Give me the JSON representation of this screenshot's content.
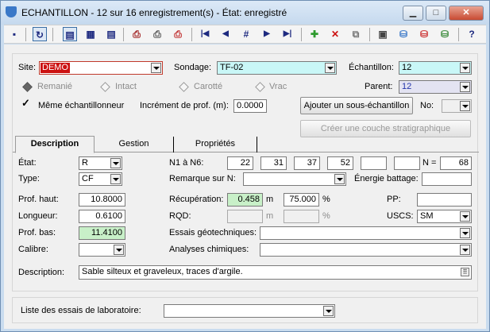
{
  "window": {
    "title": "ECHANTILLON - 12 sur 16 enregistrement(s) - État: enregistré",
    "minimize": "▁",
    "maximize": "□",
    "close": "✕"
  },
  "toolbar": {
    "icons": [
      "save-icon",
      "refresh-icon",
      "form-view-icon",
      "grid-view-icon",
      "list-view-icon",
      "print-icon",
      "print-all-icon",
      "print-delete-icon",
      "first-record-icon",
      "previous-record-icon",
      "goto-record-icon",
      "next-record-icon",
      "last-record-icon",
      "add-record-icon",
      "delete-record-icon",
      "copy-record-icon",
      "folder-icon",
      "database-icon",
      "database-add-icon",
      "database-tools-icon",
      "help-icon"
    ],
    "glyphs": {
      "first": "|◀",
      "prev": "◀",
      "goto": "#",
      "next": "▶",
      "last": "▶|",
      "add": "✚",
      "delete": "✕",
      "help": "?"
    }
  },
  "header": {
    "site_label": "Site:",
    "site_value": "DEMO",
    "sondage_label": "Sondage:",
    "sondage_value": "TF-02",
    "echantillon_label": "Échantillon:",
    "echantillon_value": "12",
    "parent_label": "Parent:",
    "parent_value": "12",
    "type_options": [
      {
        "label": "Remanié",
        "selected": true
      },
      {
        "label": "Intact",
        "selected": false
      },
      {
        "label": "Carotté",
        "selected": false
      },
      {
        "label": "Vrac",
        "selected": false
      }
    ],
    "meme_echantillonneur_label": "Même échantillonneur",
    "meme_echantillonneur_checked": true,
    "increment_label": "Incrément de prof. (m):",
    "increment_value": "0.0000",
    "add_subsample_button": "Ajouter un sous-échantillon",
    "no_label": "No:",
    "create_layer_button": "Créer une couche stratigraphique"
  },
  "tabs": [
    {
      "label": "Description",
      "active": true
    },
    {
      "label": "Gestion",
      "active": false
    },
    {
      "label": "Propriétés",
      "active": false
    }
  ],
  "description": {
    "etat_label": "État:",
    "etat_value": "R",
    "type_label": "Type:",
    "type_value": "CF",
    "n1n6_label": "N1 à N6:",
    "n_values": [
      "22",
      "31",
      "37",
      "52",
      "",
      ""
    ],
    "n_label": "N =",
    "n_value": "68",
    "remarque_label": "Remarque sur N:",
    "remarque_value": "",
    "energie_label": "Énergie battage:",
    "energie_value": "",
    "prof_haut_label": "Prof. haut:",
    "prof_haut_value": "10.8000",
    "longueur_label": "Longueur:",
    "longueur_value": "0.6100",
    "prof_bas_label": "Prof. bas:",
    "prof_bas_value": "11.4100",
    "calibre_label": "Calibre:",
    "calibre_value": "",
    "recuperation_label": "Récupération:",
    "recuperation_value": "0.458",
    "recuperation_unit": "m",
    "recuperation_pct": "75.000",
    "pct_unit": "%",
    "rqd_label": "RQD:",
    "rqd_value": "",
    "rqd_unit": "m",
    "rqd_pct": "",
    "pp_label": "PP:",
    "pp_value": "",
    "uscs_label": "USCS:",
    "uscs_value": "SM",
    "essais_label": "Essais géotechniques:",
    "essais_value": "",
    "analyses_label": "Analyses chimiques:",
    "analyses_value": "",
    "desc_label": "Description:",
    "desc_value": "Sable silteux et graveleux, traces d'argile."
  },
  "footer": {
    "liste_label": "Liste des essais de laboratoire:",
    "liste_value": ""
  }
}
